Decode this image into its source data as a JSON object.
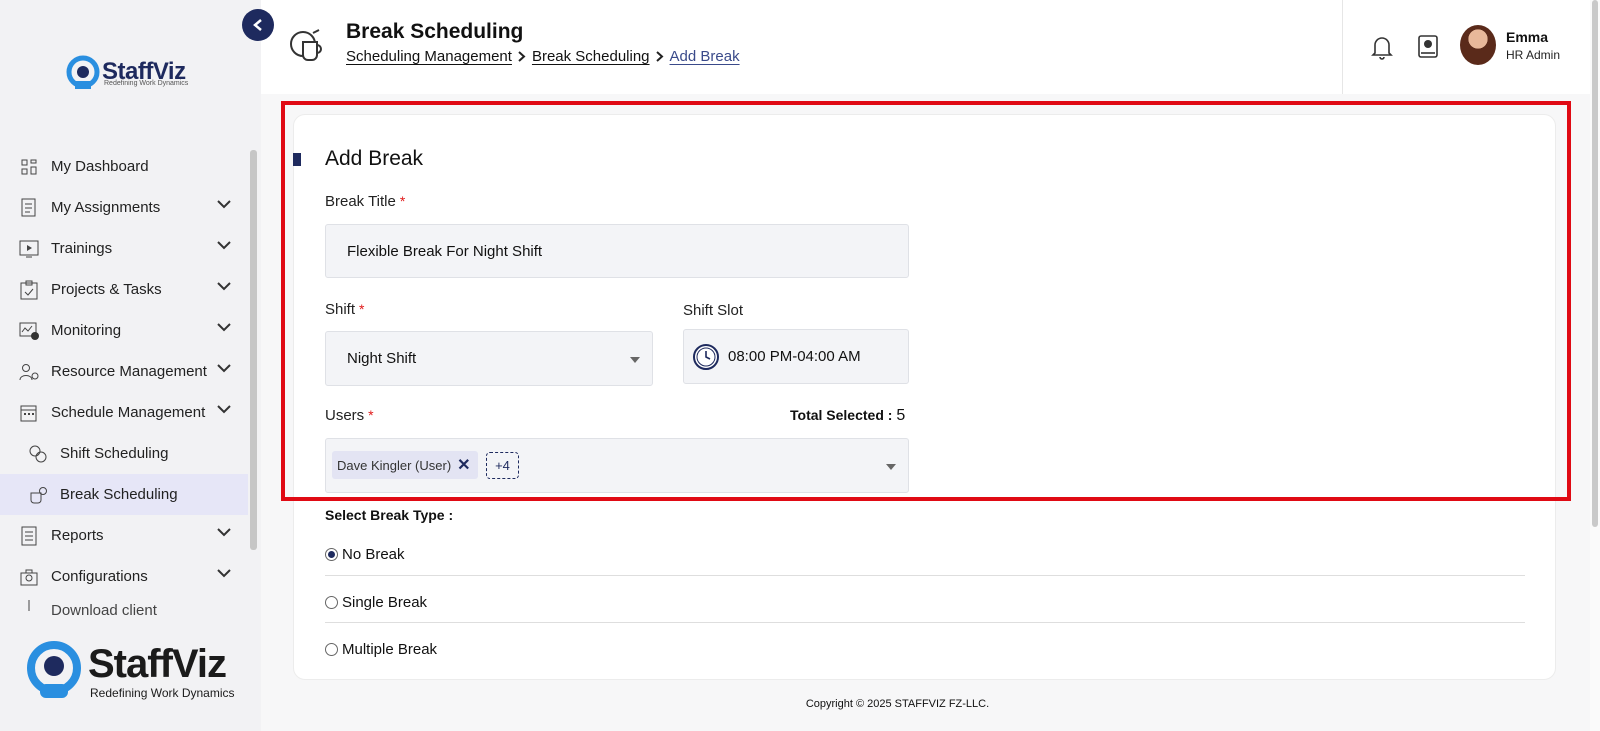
{
  "brand": {
    "name": "StaffViz",
    "tagline_small": "Redefining Work Dynamics",
    "tagline_large": "Redefining Work Dynamics"
  },
  "sidebar": {
    "items": [
      {
        "label": "My Dashboard",
        "icon": "dashboard-icon",
        "has_submenu": false
      },
      {
        "label": "My Assignments",
        "icon": "assignments-icon",
        "has_submenu": true
      },
      {
        "label": "Trainings",
        "icon": "play-icon",
        "has_submenu": true
      },
      {
        "label": "Projects & Tasks",
        "icon": "clipboard-check-icon",
        "has_submenu": true
      },
      {
        "label": "Monitoring",
        "icon": "monitoring-icon",
        "has_submenu": true
      },
      {
        "label": "Resource Management",
        "icon": "resource-icon",
        "has_submenu": true
      },
      {
        "label": "Schedule Management",
        "icon": "calendar-icon",
        "has_submenu": true
      },
      {
        "label": "Shift Scheduling",
        "icon": "shift-icon",
        "sub": true
      },
      {
        "label": "Break Scheduling",
        "icon": "break-icon",
        "sub": true,
        "active": true
      },
      {
        "label": "Reports",
        "icon": "report-icon",
        "has_submenu": true
      },
      {
        "label": "Configurations",
        "icon": "config-icon",
        "has_submenu": true
      },
      {
        "label": "Download client",
        "icon": "download-icon",
        "partial": true
      }
    ]
  },
  "header": {
    "title": "Break Scheduling",
    "breadcrumb": [
      "Scheduling Management",
      "Break Scheduling",
      "Add Break"
    ],
    "user": {
      "name": "Emma",
      "role": "HR Admin"
    }
  },
  "form": {
    "section_title": "Add Break",
    "break_title_label": "Break Title",
    "break_title_value": "Flexible Break For Night Shift",
    "shift_label": "Shift",
    "shift_value": "Night Shift",
    "shift_slot_label": "Shift Slot",
    "shift_slot_value": "08:00 PM-04:00 AM",
    "users_label": "Users",
    "total_selected_label": "Total Selected :",
    "total_selected_value": "5",
    "user_chip": "Dave Kingler (User)",
    "more_chip": "+4",
    "break_type_label": "Select Break Type :",
    "break_types": [
      {
        "label": "No Break",
        "selected": true
      },
      {
        "label": "Single Break",
        "selected": false
      },
      {
        "label": "Multiple Break",
        "selected": false
      }
    ]
  },
  "footer": {
    "copyright": "Copyright © 2025 STAFFVIZ FZ-LLC."
  },
  "colors": {
    "brand_navy": "#1e2a5e",
    "highlight_red": "#e00a14",
    "required_red": "#e01919"
  }
}
